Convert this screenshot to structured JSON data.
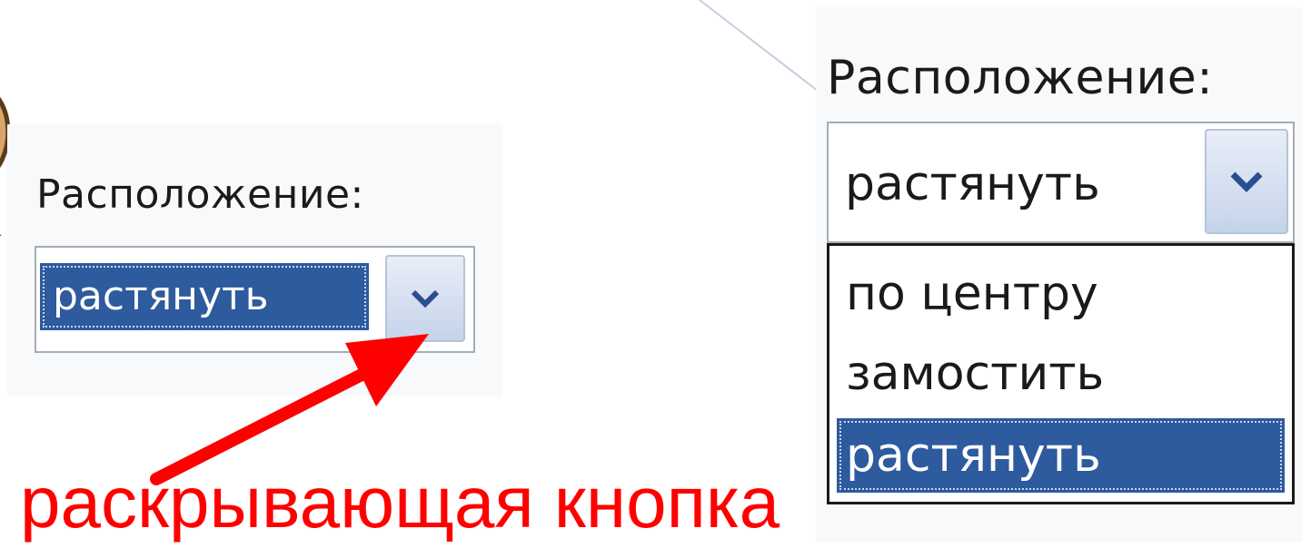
{
  "left_combo": {
    "label": "Расположение:",
    "selected_value": "растянуть"
  },
  "caption": "раскрывающая кнопка",
  "right_combo": {
    "label": "Расположение:",
    "selected_value": "растянуть",
    "options": [
      "по центру",
      "замостить",
      "растянуть"
    ],
    "highlighted_option": "растянуть"
  },
  "icons": {
    "dropdown_button": "chevron-down-icon",
    "pointer_arrow": "arrow-icon"
  },
  "colors": {
    "selection": "#2e5a9e",
    "caption": "#ff0000",
    "button": "#c5d3ea"
  }
}
